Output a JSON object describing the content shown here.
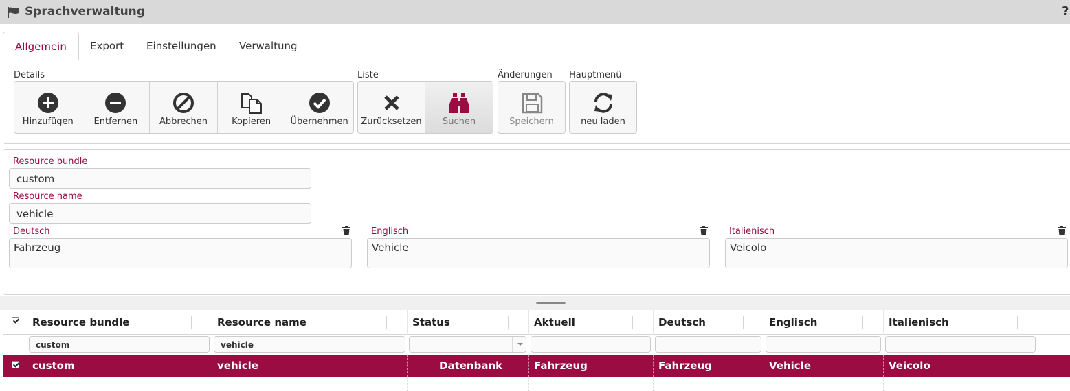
{
  "window": {
    "title": "Sprachverwaltung",
    "help_label": "?"
  },
  "tabs": [
    {
      "label": "Allgemein",
      "active": true
    },
    {
      "label": "Export"
    },
    {
      "label": "Einstellungen"
    },
    {
      "label": "Verwaltung"
    }
  ],
  "toolbar": {
    "details": {
      "label": "Details",
      "buttons": [
        {
          "label": "Hinzufügen",
          "icon": "plus-circle-icon"
        },
        {
          "label": "Entfernen",
          "icon": "minus-circle-icon"
        },
        {
          "label": "Abbrechen",
          "icon": "ban-icon"
        },
        {
          "label": "Kopieren",
          "icon": "copy-icon"
        },
        {
          "label": "Übernehmen",
          "icon": "check-circle-icon"
        }
      ]
    },
    "liste": {
      "label": "Liste",
      "buttons": [
        {
          "label": "Zurücksetzen",
          "icon": "x-icon"
        },
        {
          "label": "Suchen",
          "icon": "binoculars-icon",
          "pressed": true
        }
      ]
    },
    "aenderungen": {
      "label": "Änderungen",
      "buttons": [
        {
          "label": "Speichern",
          "icon": "floppy-icon",
          "disabled": true
        }
      ]
    },
    "hauptmenu": {
      "label": "Hauptmenü",
      "buttons": [
        {
          "label": "neu laden",
          "icon": "refresh-icon"
        }
      ]
    }
  },
  "form": {
    "resource_bundle": {
      "label": "Resource bundle",
      "value": "custom"
    },
    "resource_name": {
      "label": "Resource name",
      "value": "vehicle"
    },
    "deutsch": {
      "label": "Deutsch",
      "value": "Fahrzeug"
    },
    "englisch": {
      "label": "Englisch",
      "value": "Vehicle"
    },
    "italienisch": {
      "label": "Italienisch",
      "value": "Veicolo"
    }
  },
  "grid": {
    "columns": [
      "Resource bundle",
      "Resource name",
      "Status",
      "Aktuell",
      "Deutsch",
      "Englisch",
      "Italienisch"
    ],
    "filters": {
      "resource_bundle": "custom",
      "resource_name": "vehicle",
      "status": "",
      "aktuell": "",
      "deutsch": "",
      "englisch": "",
      "italienisch": ""
    },
    "rows": [
      {
        "resource_bundle": "custom",
        "resource_name": "vehicle",
        "status": "Datenbank",
        "aktuell": "Fahrzeug",
        "deutsch": "Fahrzeug",
        "englisch": "Vehicle",
        "italienisch": "Veicolo",
        "selected": true
      }
    ]
  },
  "colors": {
    "accent": "#9a0c42",
    "titlebar": "#d9d9d9",
    "text": "#333333"
  }
}
